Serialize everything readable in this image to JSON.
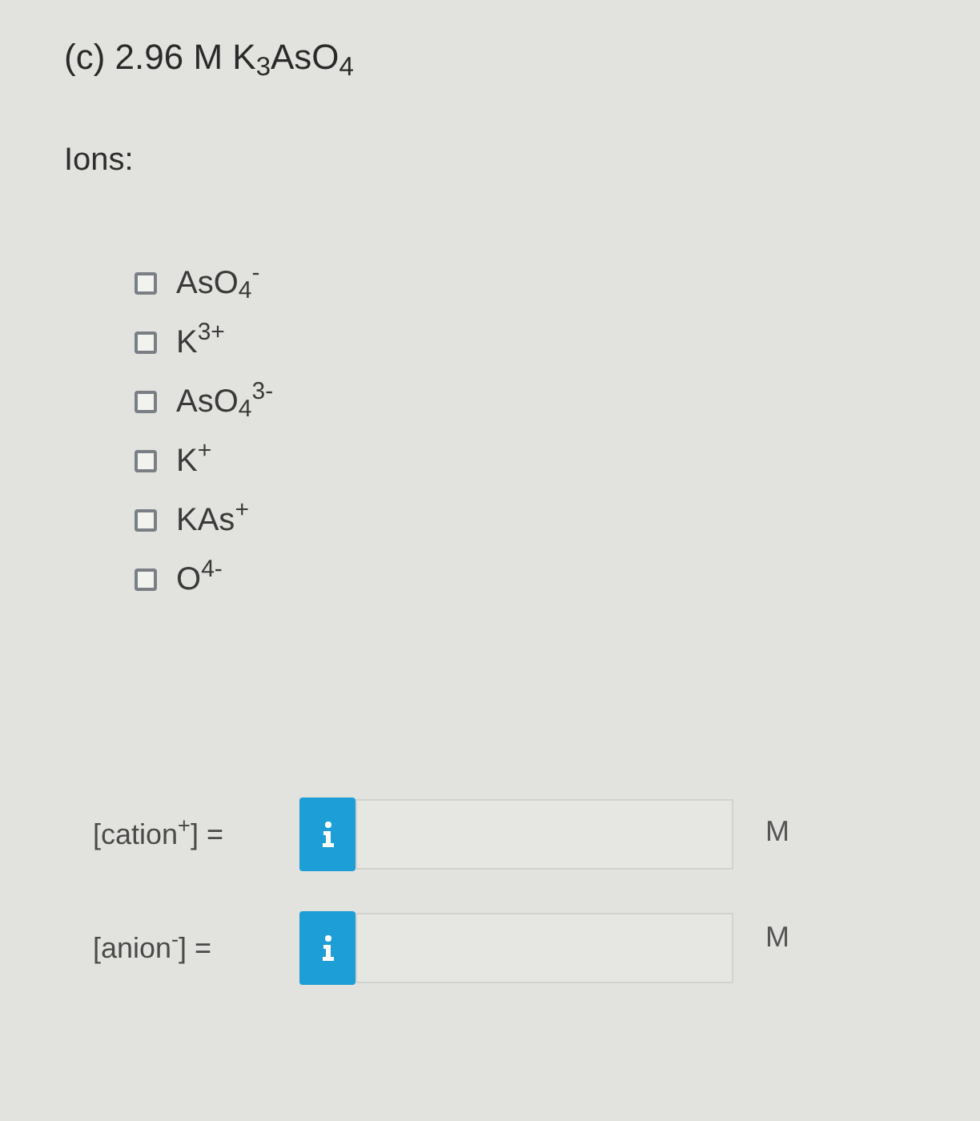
{
  "question": {
    "label": "(c) 2.96 M K$_{3}$AsO$_{4}$"
  },
  "ions_heading": "Ions:",
  "ions": [
    {
      "label": "AsO$_{4}$$^{-}$",
      "checked": false
    },
    {
      "label": "K$^{3+}$",
      "checked": false
    },
    {
      "label": "AsO$_{4}$$^{3-}$",
      "checked": false
    },
    {
      "label": "K$^{+}$",
      "checked": false
    },
    {
      "label": "KAs$^{+}$",
      "checked": false
    },
    {
      "label": "O$^{4-}$",
      "checked": false
    }
  ],
  "answers": [
    {
      "label": "[cation$^{+}$] =",
      "unit": "M"
    },
    {
      "label": "[anion$^{-}$] =",
      "unit": "M"
    }
  ]
}
